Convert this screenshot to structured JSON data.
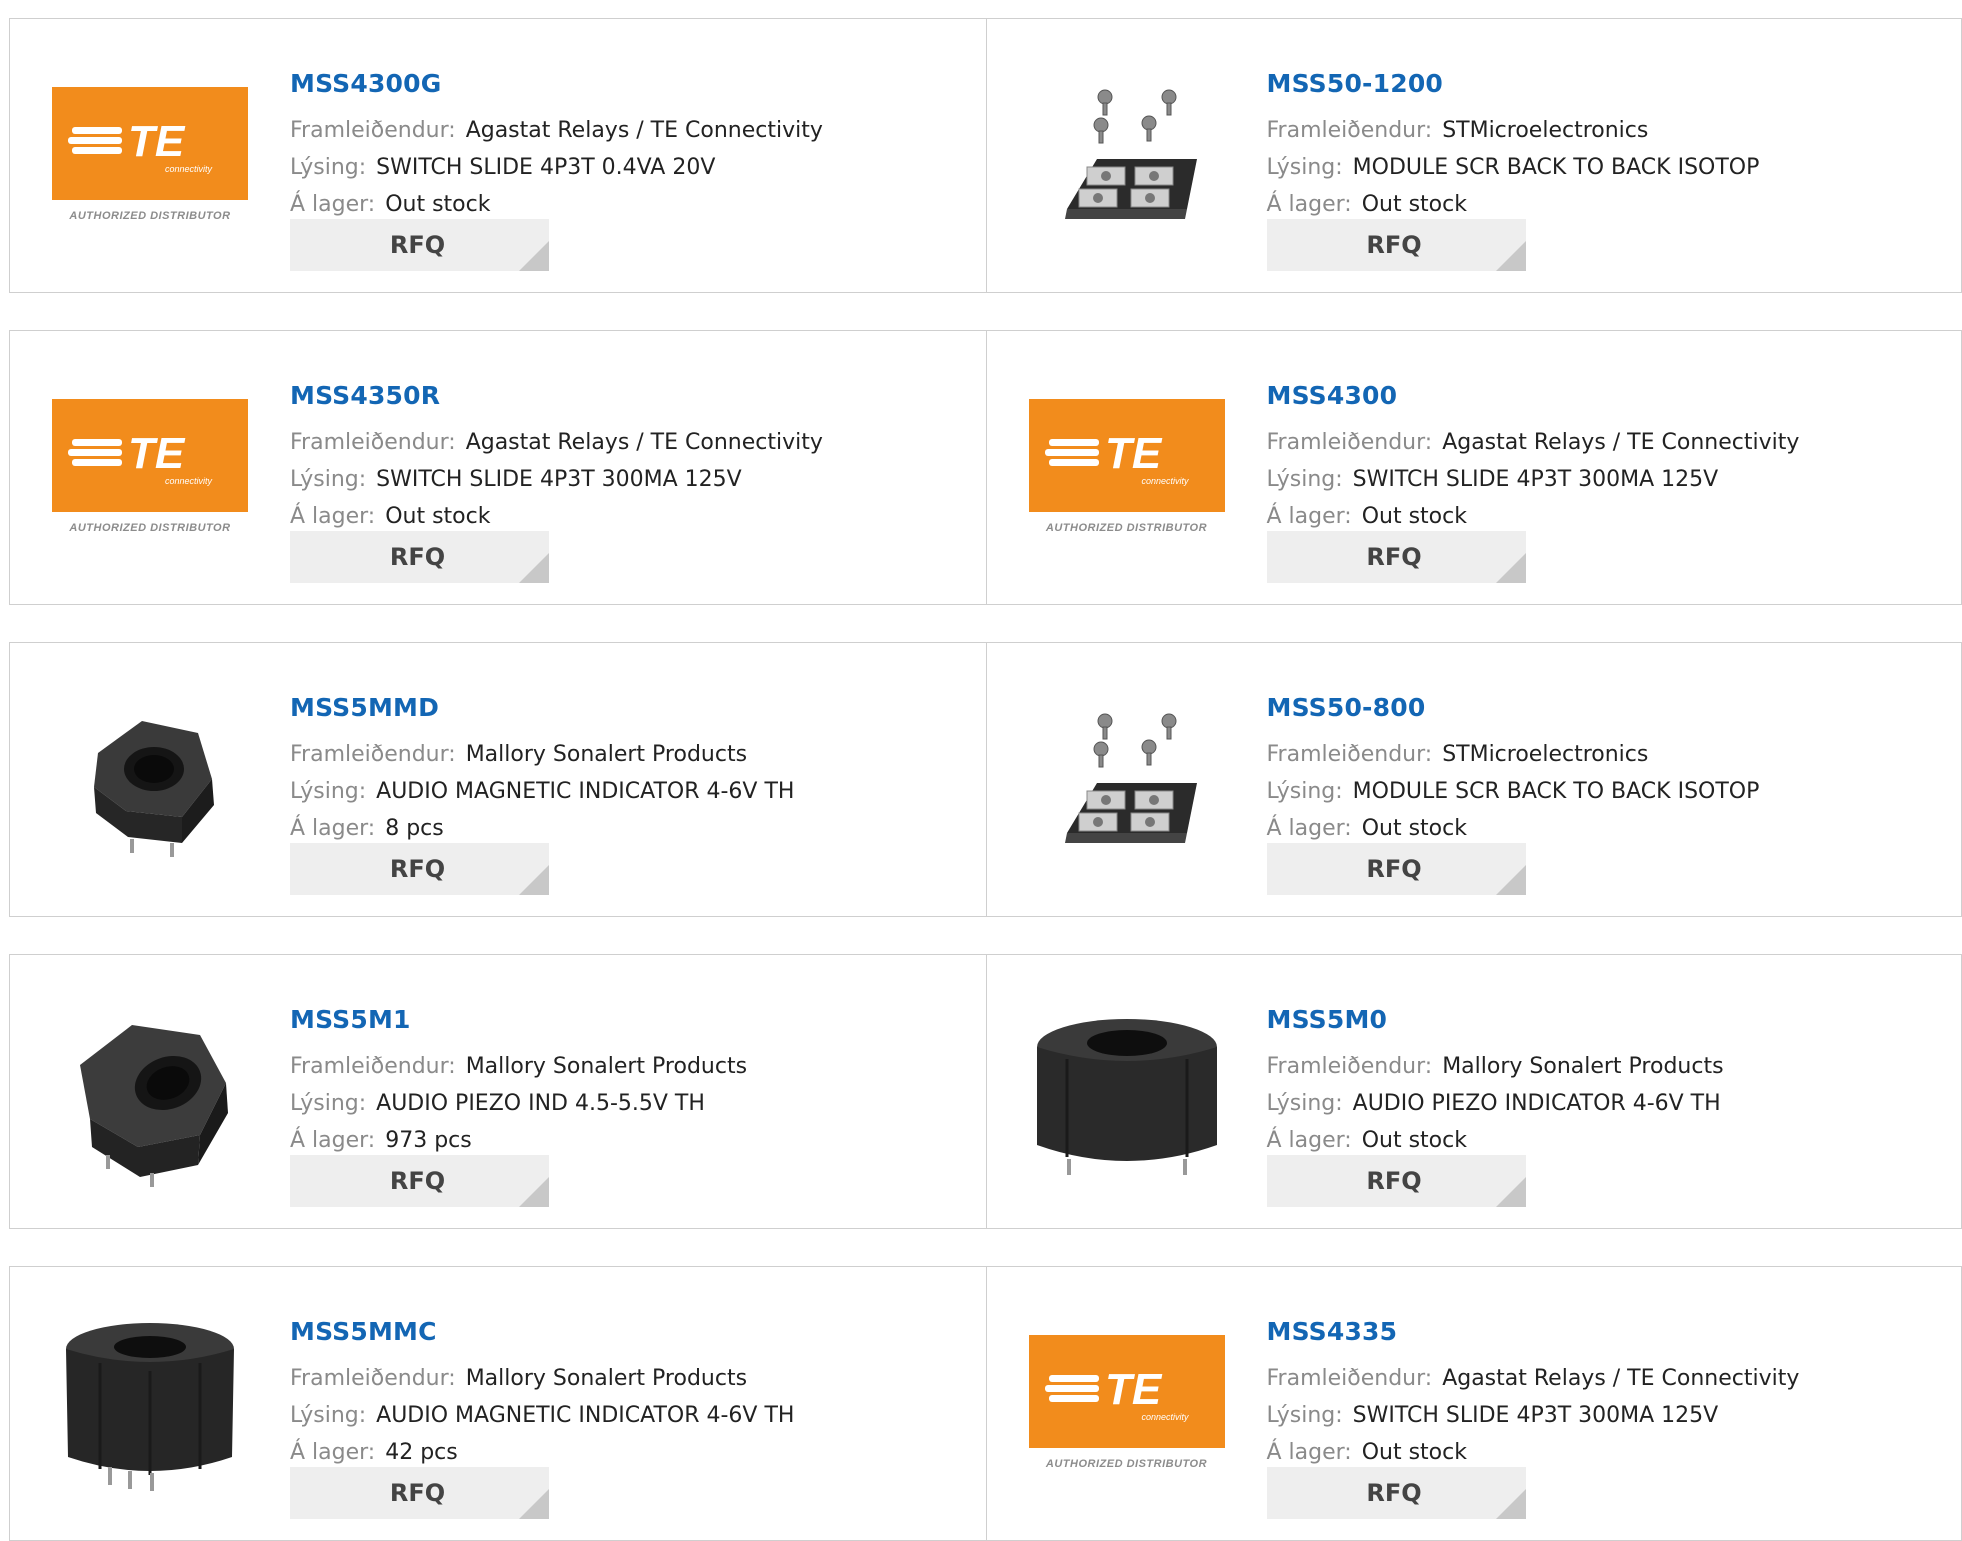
{
  "labels": {
    "manufacturer": "Framleiðendur:",
    "description": "Lýsing:",
    "stock": "Á lager:",
    "rfq": "RFQ"
  },
  "te_logo": {
    "mark": "TE",
    "subtext": "connectivity",
    "caption": "AUTHORIZED DISTRIBUTOR",
    "color": "#f28c1c"
  },
  "colors": {
    "part_link": "#1366b4",
    "label": "#8a8a8a",
    "button_bg": "#eeeeee"
  },
  "products": [
    {
      "part": "MSS4300G",
      "manufacturer": "Agastat Relays / TE Connectivity",
      "description": "SWITCH SLIDE 4P3T 0.4VA 20V",
      "stock": "Out stock",
      "image": "te-logo"
    },
    {
      "part": "MSS50-1200",
      "manufacturer": "STMicroelectronics",
      "description": "MODULE SCR BACK TO BACK ISOTOP",
      "stock": "Out stock",
      "image": "isotop-module"
    },
    {
      "part": "MSS4350R",
      "manufacturer": "Agastat Relays / TE Connectivity",
      "description": "SWITCH SLIDE 4P3T 300MA 125V",
      "stock": "Out stock",
      "image": "te-logo"
    },
    {
      "part": "MSS4300",
      "manufacturer": "Agastat Relays / TE Connectivity",
      "description": "SWITCH SLIDE 4P3T 300MA 125V",
      "stock": "Out stock",
      "image": "te-logo"
    },
    {
      "part": "MSS5MMD",
      "manufacturer": "Mallory Sonalert Products",
      "description": "AUDIO MAGNETIC INDICATOR 4-6V TH",
      "stock": "8 pcs",
      "image": "buzzer-tilted"
    },
    {
      "part": "MSS50-800",
      "manufacturer": "STMicroelectronics",
      "description": "MODULE SCR BACK TO BACK ISOTOP",
      "stock": "Out stock",
      "image": "isotop-module"
    },
    {
      "part": "MSS5M1",
      "manufacturer": "Mallory Sonalert Products",
      "description": "AUDIO PIEZO IND 4.5-5.5V TH",
      "stock": "973 pcs",
      "image": "buzzer-tilted"
    },
    {
      "part": "MSS5M0",
      "manufacturer": "Mallory Sonalert Products",
      "description": "AUDIO PIEZO INDICATOR 4-6V TH",
      "stock": "Out stock",
      "image": "buzzer-front"
    },
    {
      "part": "MSS5MMC",
      "manufacturer": "Mallory Sonalert Products",
      "description": "AUDIO MAGNETIC INDICATOR 4-6V TH",
      "stock": "42 pcs",
      "image": "buzzer-front"
    },
    {
      "part": "MSS4335",
      "manufacturer": "Agastat Relays / TE Connectivity",
      "description": "SWITCH SLIDE 4P3T 300MA 125V",
      "stock": "Out stock",
      "image": "te-logo"
    }
  ]
}
